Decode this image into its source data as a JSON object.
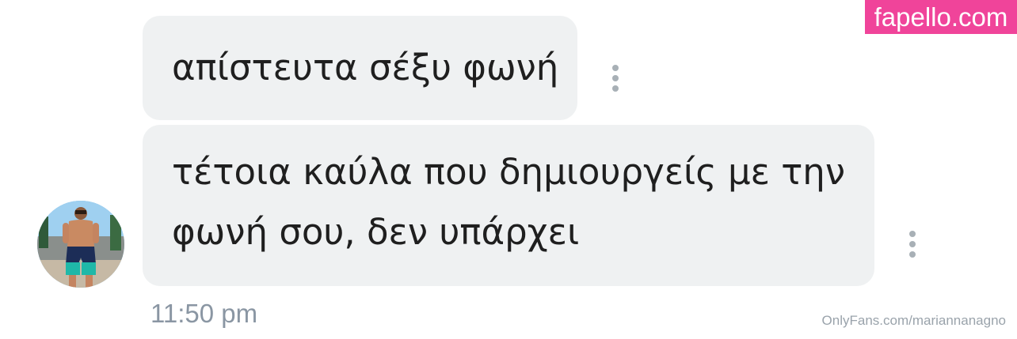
{
  "messages": [
    {
      "text_lines": [
        "απίστευτα σέξυ φωνή"
      ]
    },
    {
      "text_lines": [
        "τέτοια καύλα που δημιουργείς με την",
        "φωνή σου, δεν υπάρχει"
      ]
    }
  ],
  "timestamp": "11:50 pm",
  "watermark": "OnlyFans.com/mariannanagno",
  "badge": "fapello.com",
  "icons": {
    "message_menu": "more-vertical-icon",
    "avatar": "user-avatar-photo"
  },
  "colors": {
    "bubble": "#eff1f2",
    "text": "#1f1f1f",
    "timestamp": "#8a96a3",
    "badge": "#f0449a",
    "menu_dots": "#a8b0b6"
  }
}
